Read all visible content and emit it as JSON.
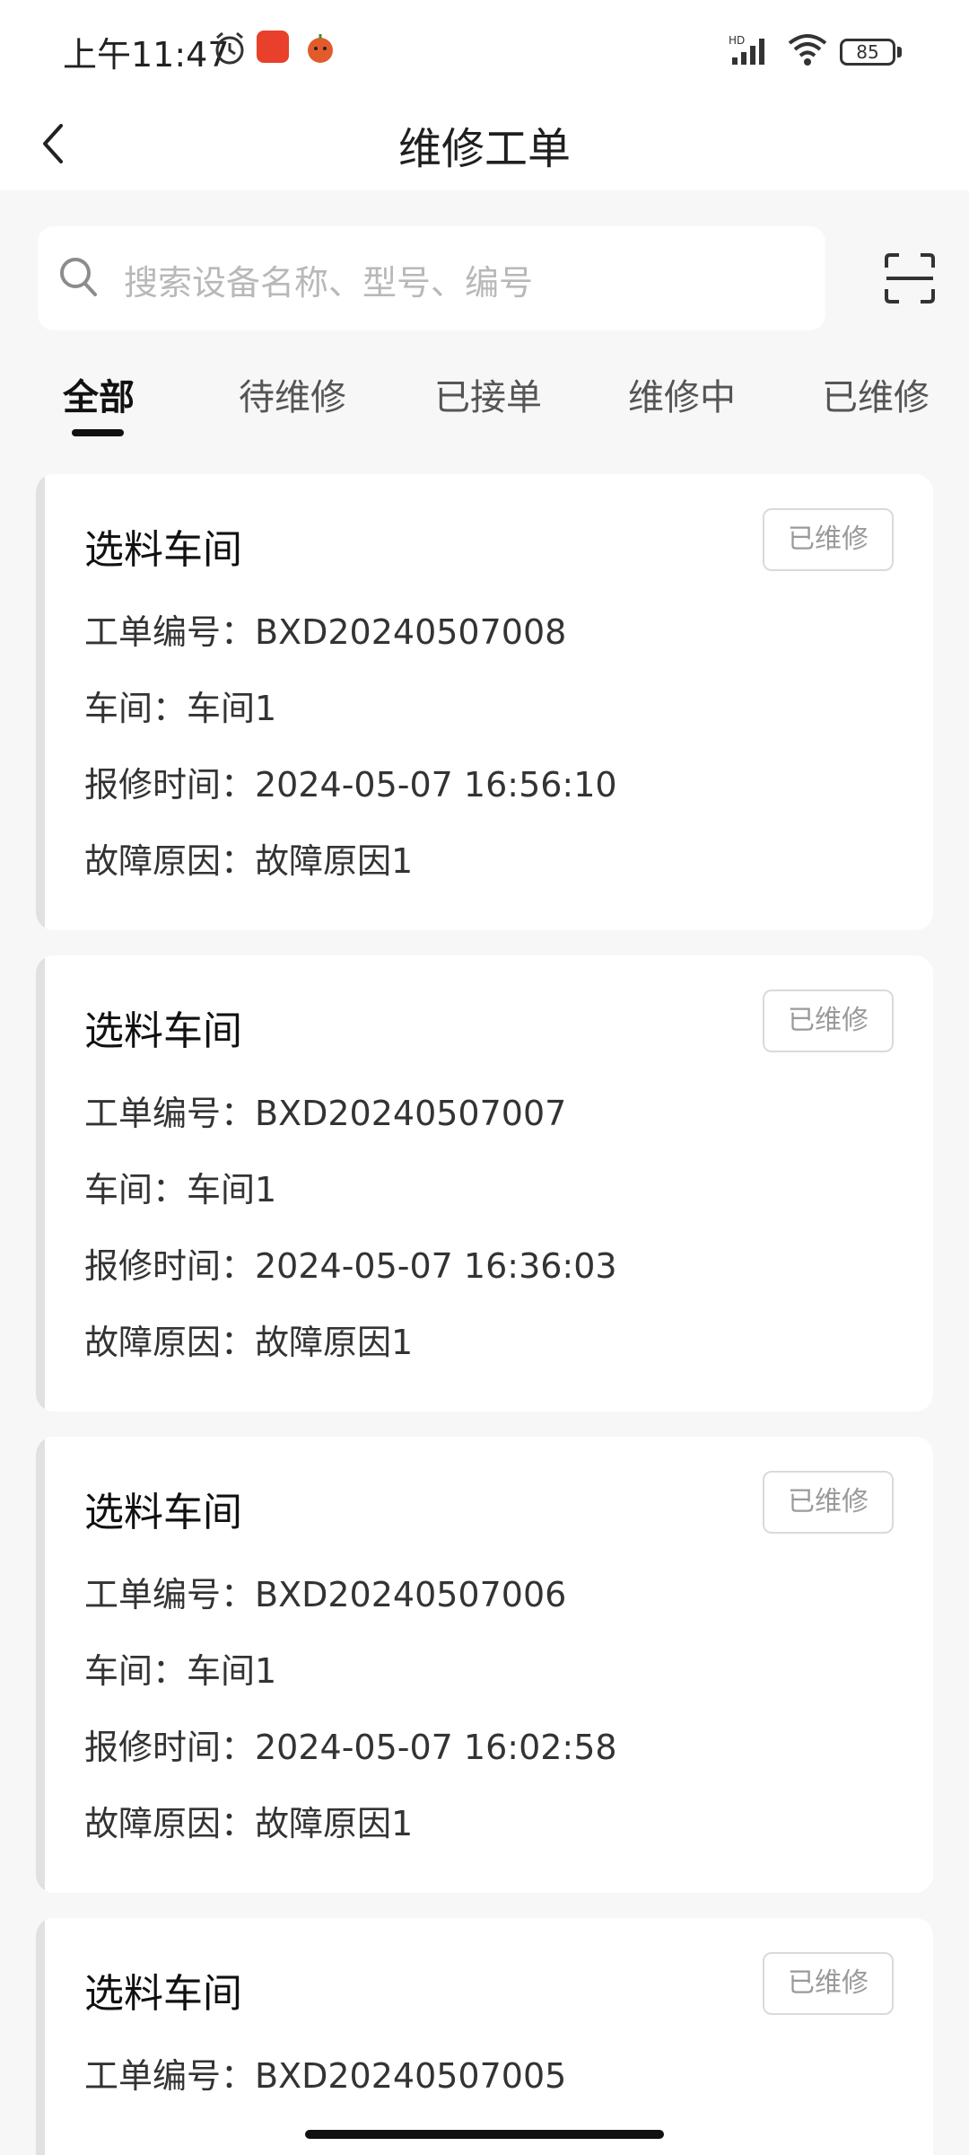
{
  "status_bar": {
    "time": "上午11:47",
    "battery": "85",
    "icons": [
      "alarm-icon",
      "app-icon",
      "app-icon",
      "signal-icon",
      "wifi-icon",
      "battery-icon"
    ]
  },
  "header": {
    "title": "维修工单"
  },
  "search": {
    "placeholder": "搜索设备名称、型号、编号"
  },
  "tabs": [
    {
      "label": "全部",
      "active": true
    },
    {
      "label": "待维修",
      "active": false
    },
    {
      "label": "已接单",
      "active": false
    },
    {
      "label": "维修中",
      "active": false
    },
    {
      "label": "已维修",
      "active": false
    }
  ],
  "orders": [
    {
      "title": "选料车间",
      "status": "已维修",
      "order_no_label": "工单编号：BXD20240507008",
      "workshop_label": "车间：车间1",
      "time_label": "报修时间：2024-05-07 16:56:10",
      "reason_label": "故障原因：故障原因1"
    },
    {
      "title": "选料车间",
      "status": "已维修",
      "order_no_label": "工单编号：BXD20240507007",
      "workshop_label": "车间：车间1",
      "time_label": "报修时间：2024-05-07 16:36:03",
      "reason_label": "故障原因：故障原因1"
    },
    {
      "title": "选料车间",
      "status": "已维修",
      "order_no_label": "工单编号：BXD20240507006",
      "workshop_label": "车间：车间1",
      "time_label": "报修时间：2024-05-07 16:02:58",
      "reason_label": "故障原因：故障原因1"
    },
    {
      "title": "选料车间",
      "status": "已维修",
      "order_no_label": "工单编号：BXD20240507005"
    }
  ]
}
